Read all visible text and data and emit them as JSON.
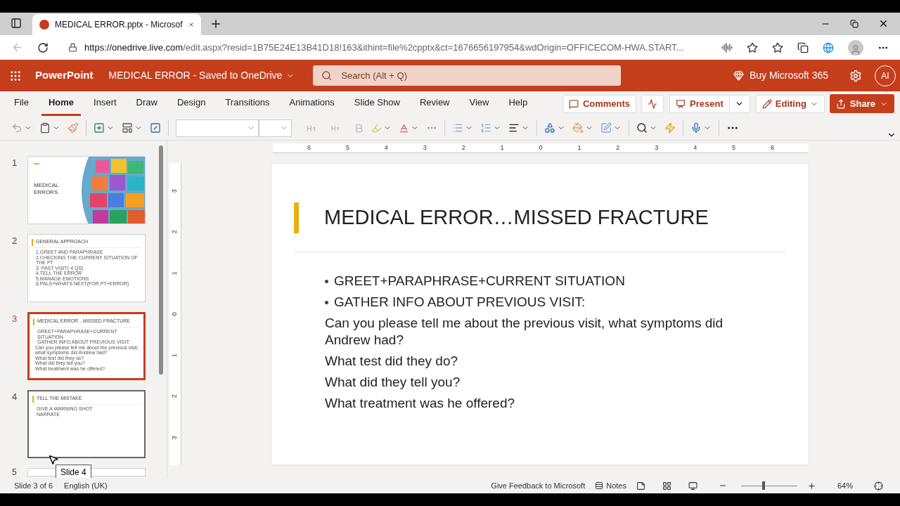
{
  "browser": {
    "tab_title": "MEDICAL ERROR.pptx - Microsof",
    "url_host": "https://onedrive.live.com",
    "url_rest": "/edit.aspx?resid=1B75E24E13B41D18!163&ithint=file%2cpptx&ct=1676656197954&wdOrigin=OFFICECOM-HWA.START..."
  },
  "app": {
    "name": "PowerPoint",
    "doc_title": "MEDICAL ERROR",
    "separator": "-",
    "save_status": "Saved to OneDrive",
    "search_placeholder": "Search (Alt + Q)",
    "buy": "Buy Microsoft 365",
    "avatar": "AI"
  },
  "ribbon_tabs": [
    {
      "label": "File",
      "selected": false
    },
    {
      "label": "Home",
      "selected": true
    },
    {
      "label": "Insert",
      "selected": false
    },
    {
      "label": "Draw",
      "selected": false
    },
    {
      "label": "Design",
      "selected": false
    },
    {
      "label": "Transitions",
      "selected": false
    },
    {
      "label": "Animations",
      "selected": false
    },
    {
      "label": "Slide Show",
      "selected": false
    },
    {
      "label": "Review",
      "selected": false
    },
    {
      "label": "View",
      "selected": false
    },
    {
      "label": "Help",
      "selected": false
    }
  ],
  "actions": {
    "comments": "Comments",
    "present": "Present",
    "editing": "Editing",
    "share": "Share"
  },
  "slides": [
    {
      "number": "1",
      "selected": false,
      "kind": "cover",
      "title": "MEDICAL ERRORS"
    },
    {
      "number": "2",
      "selected": false,
      "kind": "content",
      "title": "GENERAL APPROACH",
      "bullets": [
        "1.GREET AND PARAPHRASE",
        "2.CHECKING THE CURRENT SITUATION OF THE PT",
        "3. PAST VISIT( 4 QS)",
        "4.TELL THE ERROR",
        "5.MANAGE EMOTIONS",
        "6.PALS+WHATS NEXT(FOR PT+ERROR)"
      ]
    },
    {
      "number": "3",
      "selected": true,
      "kind": "content",
      "title": "MEDICAL ERROR…MISSED FRACTURE",
      "bullets": [
        "GREET+PARAPHRASE+CURRENT SITUATION",
        "GATHER INFO ABOUT PREVIOUS VISIT:"
      ],
      "lines": [
        "Can you please tell me about the previous visit, what symptoms did Andrew had?",
        "What test did they do?",
        "What did they tell you?",
        "What treatment was he offered?"
      ]
    },
    {
      "number": "4",
      "selected": false,
      "kind": "content",
      "title": "TELL THE MISTAKE",
      "bullets": [
        "GIVE A WARNING SHOT",
        "NARRATE"
      ]
    },
    {
      "number": "5",
      "selected": false,
      "kind": "partial"
    }
  ],
  "tooltip": "Slide 4",
  "ruler": {
    "horizontal": [
      "6",
      "5",
      "4",
      "3",
      "2",
      "1",
      "0",
      "1",
      "2",
      "3",
      "4",
      "5",
      "6"
    ],
    "vertical": [
      "3",
      "2",
      "1",
      "0",
      "1",
      "2",
      "3"
    ]
  },
  "current_slide": {
    "title": "MEDICAL ERROR…MISSED FRACTURE",
    "bullets": [
      "GREET+PARAPHRASE+CURRENT SITUATION",
      "GATHER INFO ABOUT PREVIOUS VISIT:"
    ],
    "lines": [
      "Can you please tell me about the previous visit, what symptoms did Andrew had?",
      "What test did they do?",
      "What did they tell you?",
      "What treatment was he offered?"
    ]
  },
  "status_bar": {
    "slide_position": "Slide 3 of 6",
    "language": "English (UK)",
    "feedback": "Give Feedback to Microsoft",
    "notes": "Notes",
    "zoom": "64%",
    "zoom_slider": {
      "level": 0.4
    }
  }
}
